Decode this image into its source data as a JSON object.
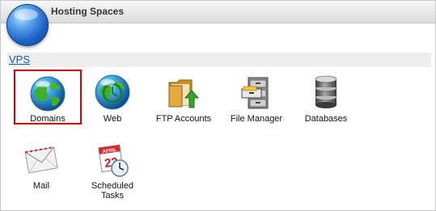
{
  "panel": {
    "title": "Hosting Spaces"
  },
  "group": {
    "name": "VPS"
  },
  "tiles": [
    {
      "label": "Domains",
      "icon": "globe-domains-icon",
      "selected": true
    },
    {
      "label": "Web",
      "icon": "globe-web-icon",
      "selected": false
    },
    {
      "label": "FTP Accounts",
      "icon": "ftp-folder-icon",
      "selected": false
    },
    {
      "label": "File Manager",
      "icon": "file-cabinet-icon",
      "selected": false
    },
    {
      "label": "Databases",
      "icon": "database-icon",
      "selected": false
    },
    {
      "label": "Mail",
      "icon": "mail-envelope-icon",
      "selected": false
    },
    {
      "label": "Scheduled Tasks",
      "icon": "calendar-clock-icon",
      "selected": false
    }
  ],
  "colors": {
    "selection_border": "#e00000",
    "link": "#1a55a8"
  }
}
